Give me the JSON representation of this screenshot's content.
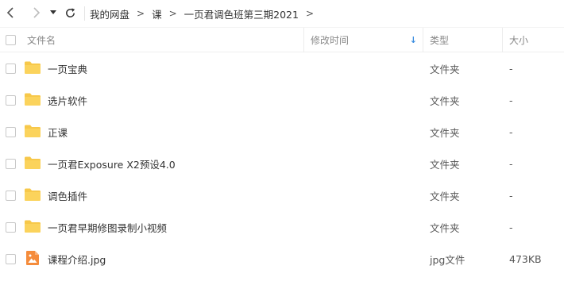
{
  "toolbar": {
    "back_icon": "chevron-left-icon",
    "forward_icon": "chevron-right-icon",
    "history_dropdown_icon": "caret-down-icon",
    "refresh_icon": "refresh-icon"
  },
  "breadcrumb": [
    "我的网盘",
    "课",
    "一页君调色班第三期2021"
  ],
  "breadcrumb_separator": ">",
  "columns": {
    "name": "文件名",
    "modified": "修改时间",
    "type": "类型",
    "size": "大小"
  },
  "sort_indicator": "↓",
  "colors": {
    "folder": "#f7c84a",
    "image_file": "#f58c3c",
    "sort_arrow": "#3c8ee0"
  },
  "files": [
    {
      "name": "一页宝典",
      "modified": "",
      "type": "文件夹",
      "size": "-",
      "icon": "folder-icon"
    },
    {
      "name": "选片软件",
      "modified": "",
      "type": "文件夹",
      "size": "-",
      "icon": "folder-icon"
    },
    {
      "name": "正课",
      "modified": "",
      "type": "文件夹",
      "size": "-",
      "icon": "folder-icon"
    },
    {
      "name": "一页君Exposure X2预设4.0",
      "modified": "",
      "type": "文件夹",
      "size": "-",
      "icon": "folder-icon"
    },
    {
      "name": "调色插件",
      "modified": "",
      "type": "文件夹",
      "size": "-",
      "icon": "folder-icon"
    },
    {
      "name": "一页君早期修图录制小视频",
      "modified": "",
      "type": "文件夹",
      "size": "-",
      "icon": "folder-icon"
    },
    {
      "name": "课程介绍.jpg",
      "modified": "",
      "type": "jpg文件",
      "size": "473KB",
      "icon": "image-file-icon"
    }
  ]
}
